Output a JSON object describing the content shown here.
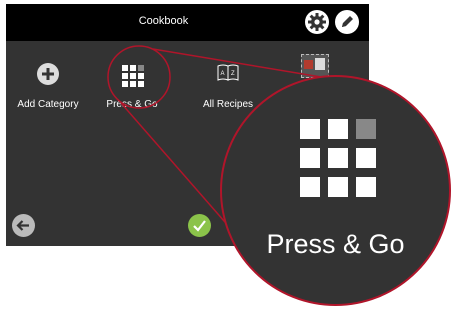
{
  "header": {
    "title": "Cookbook"
  },
  "icons": {
    "settings": "gear-icon",
    "edit": "pencil-icon",
    "add": "plus-icon",
    "press_and_go": "grid-icon",
    "all_recipes": "book-icon",
    "back": "arrow-left-icon",
    "confirm": "checkmark-icon"
  },
  "tiles": [
    {
      "label": "Add Category"
    },
    {
      "label": "Press & Go"
    },
    {
      "label": "All Recipes"
    }
  ],
  "callout": {
    "label": "Press & Go"
  },
  "colors": {
    "accent_red": "#b0152a",
    "confirm_green": "#8bc34a",
    "screen_bg": "#333333",
    "title_bar_bg": "#000000"
  }
}
